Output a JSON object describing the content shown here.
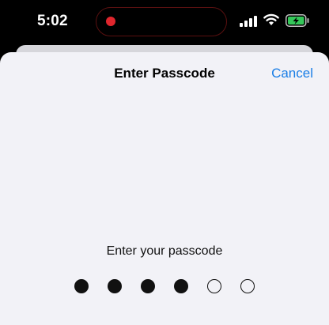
{
  "status_bar": {
    "time": "5:02",
    "recording_indicator_color": "#e0262d",
    "icons": [
      "signal-icon",
      "wifi-icon",
      "battery-charging-icon"
    ],
    "battery_color": "#34c759"
  },
  "sheet": {
    "title": "Enter Passcode",
    "cancel_label": "Cancel",
    "accent_color": "#1a7ee6"
  },
  "passcode": {
    "prompt": "Enter your passcode",
    "length": 6,
    "entered": 4
  }
}
